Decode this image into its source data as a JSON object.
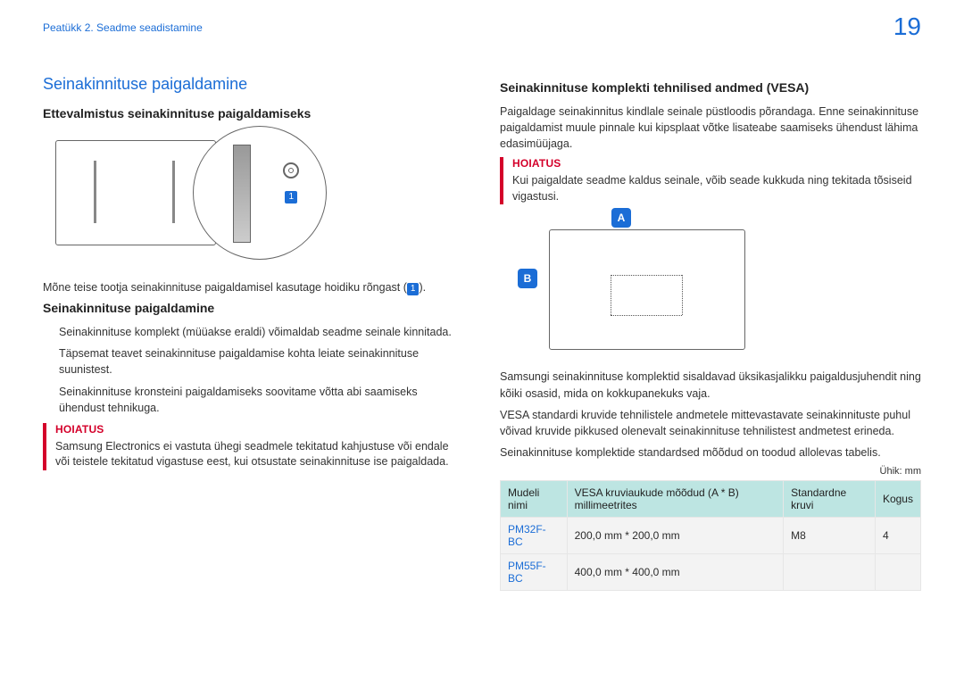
{
  "header": {
    "chapter": "Peatükk 2. Seadme seadistamine",
    "page": "19"
  },
  "left": {
    "h1": "Seinakinnituse paigaldamine",
    "prep_h2": "Ettevalmistus seinakinnituse paigaldamiseks",
    "ring_badge1": "1",
    "ring_badge2": "1",
    "ring_sentence_a": "Mõne teise tootja seinakinnituse paigaldamisel kasutage hoidiku rõngast (",
    "ring_sentence_b": ").",
    "mount_h2": "Seinakinnituse paigaldamine",
    "mount_p1": "Seinakinnituse komplekt (müüakse eraldi) võimaldab seadme seinale kinnitada.",
    "mount_p2": "Täpsemat teavet seinakinnituse paigaldamise kohta leiate seinakinnituse suunistest.",
    "mount_p3": "Seinakinnituse kronsteini paigaldamiseks soovitame võtta abi saamiseks ühendust tehnikuga.",
    "warn_label": "HOIATUS",
    "warn_text": "Samsung Electronics ei vastuta ühegi seadmele tekitatud kahjustuse või endale või teistele tekitatud vigastuse eest, kui otsustate seinakinnituse ise paigaldada."
  },
  "right": {
    "h2_vesa": "Seinakinnituse komplekti tehnilised andmed (VESA)",
    "vesa_p1": "Paigaldage seinakinnitus kindlale seinale püstloodis põrandaga. Enne seinakinnituse paigaldamist muule pinnale kui kipsplaat võtke lisateabe saamiseks ühendust lähima edasimüüjaga.",
    "warn_label": "HOIATUS",
    "warn_text": "Kui paigaldate seadme kaldus seinale, võib seade kukkuda ning tekitada tõsiseid vigastusi.",
    "dimA": "A",
    "dimB": "B",
    "kit_p1": "Samsungi seinakinnituse komplektid sisaldavad üksikasjalikku paigaldusjuhendit ning kõiki osasid, mida on kokkupanekuks vaja.",
    "kit_p2": "VESA standardi kruvide tehnilistele andmetele mittevastavate seinakinnituste puhul võivad kruvide pikkused olenevalt seinakinnituse tehnilistest andmetest erineda.",
    "kit_p3": "Seinakinnituse komplektide standardsed mõõdud on toodud allolevas tabelis.",
    "unit": "Ühik: mm",
    "table": {
      "h_model": "Mudeli nimi",
      "h_vesa": "VESA kruviaukude mõõdud (A * B) millimeetrites",
      "h_screw": "Standardne kruvi",
      "h_qty": "Kogus",
      "rows": [
        {
          "model": "PM32F-BC",
          "vesa": "200,0 mm * 200,0 mm",
          "screw": "M8",
          "qty": "4"
        },
        {
          "model": "PM55F-BC",
          "vesa": "400,0 mm * 400,0 mm",
          "screw": "",
          "qty": ""
        }
      ]
    }
  }
}
